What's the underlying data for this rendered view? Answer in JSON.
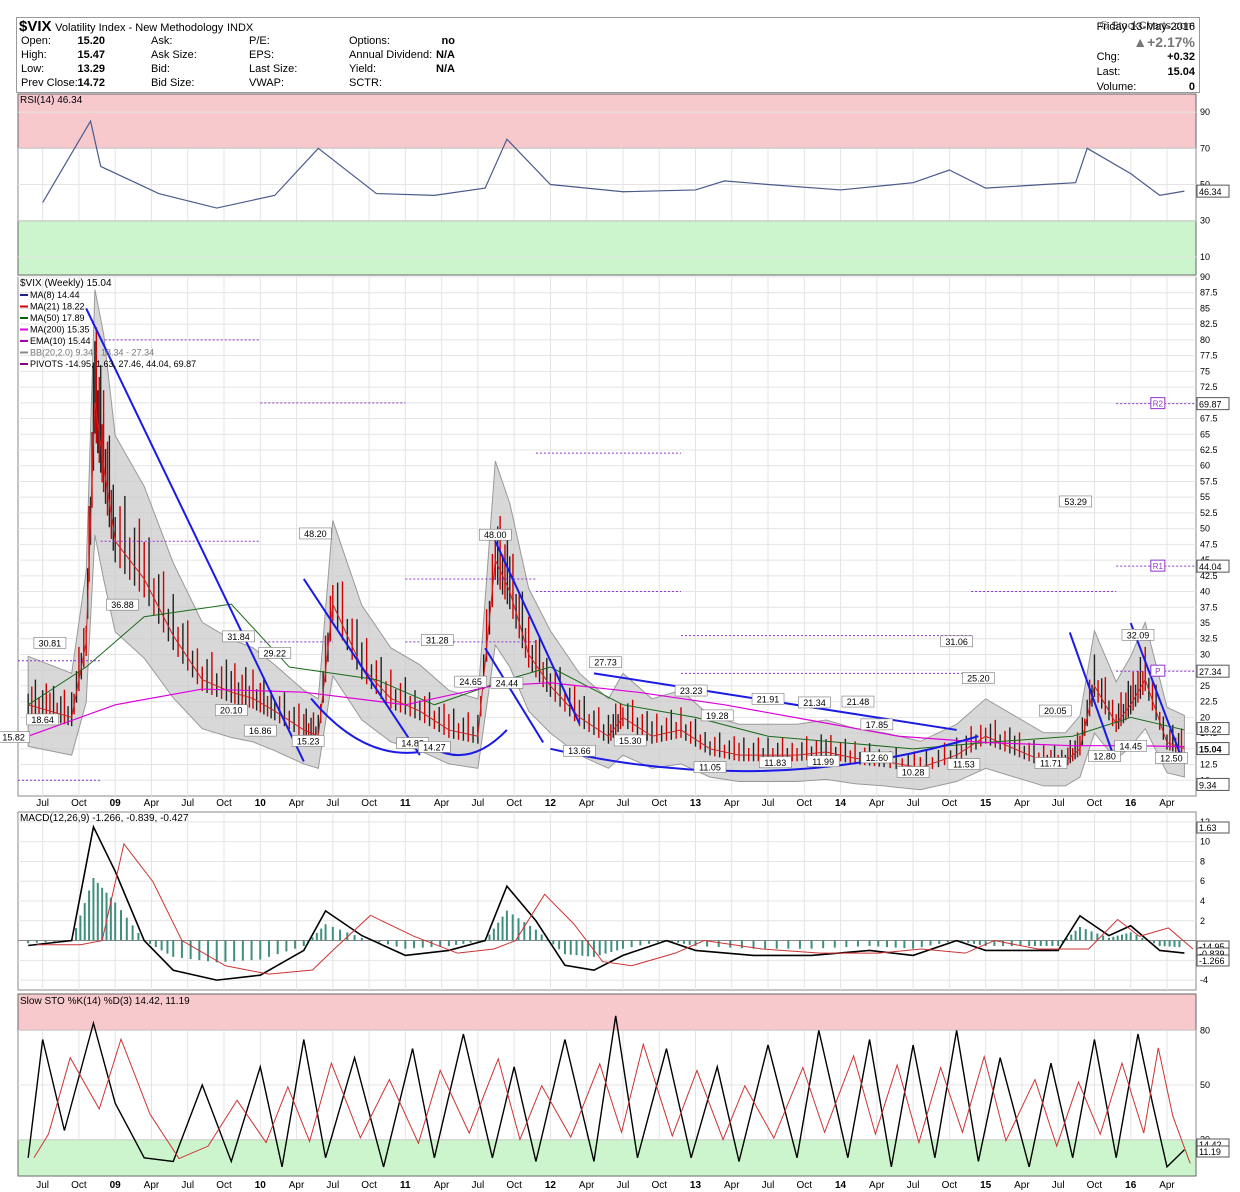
{
  "header": {
    "symbol": "$VIX",
    "name": "Volatility Index - New Methodology",
    "exchange": "INDX",
    "site": "© StockCharts.com",
    "date": "Friday  13-May-2016",
    "change_pct": "▲+2.17%",
    "quote_labels": [
      "Open:",
      "High:",
      "Low:",
      "Prev Close:"
    ],
    "quote_values": [
      "15.20",
      "15.47",
      "13.29",
      "14.72"
    ],
    "ask_labels": [
      "Ask:",
      "Ask Size:",
      "Bid:",
      "Bid Size:"
    ],
    "pe_labels": [
      "P/E:",
      "EPS:",
      "Last Size:",
      "VWAP:"
    ],
    "opt_labels": [
      "Options:",
      "Annual Dividend:",
      "Yield:",
      "SCTR:"
    ],
    "opt_values": [
      "no",
      "N/A",
      "N/A",
      ""
    ],
    "right_labels": [
      "Chg:",
      "Last:",
      "Volume:"
    ],
    "right_values": [
      "+0.32",
      "15.04",
      "0"
    ]
  },
  "chart_data": [
    {
      "type": "line",
      "panel": "rsi",
      "title": "RSI(14) 46.34",
      "ylim": [
        0,
        100
      ],
      "y_ticks": [
        10,
        30,
        50,
        70,
        90
      ],
      "bands": {
        "overbought": 70,
        "oversold": 30
      },
      "last_value_label": "46.34",
      "x": [
        2008.5,
        2008.83,
        2008.9,
        2009.3,
        2009.7,
        2010.1,
        2010.4,
        2010.8,
        2011.2,
        2011.55,
        2011.7,
        2012.0,
        2012.5,
        2013.0,
        2013.2,
        2013.5,
        2014.0,
        2014.5,
        2014.75,
        2015.0,
        2015.4,
        2015.62,
        2015.7,
        2016.0,
        2016.2,
        2016.37
      ],
      "values": [
        40,
        85,
        60,
        45,
        37,
        44,
        70,
        45,
        44,
        48,
        75,
        50,
        46,
        47,
        52,
        50,
        47,
        51,
        58,
        48,
        50,
        51,
        70,
        56,
        44,
        46.34
      ]
    },
    {
      "type": "bar",
      "panel": "price",
      "title": "$VIX (Weekly) 15.04",
      "legend": [
        "MA(8) 14.44",
        "MA(21) 18.22",
        "MA(50) 17.89",
        "MA(200) 15.35",
        "EMA(10) 15.44",
        "BB(20,2.0) 9.34 - 18.34 - 27.34",
        "PIVOTS -14.95, 1.63, 27.46, 44.04, 69.87"
      ],
      "legend_colors": [
        "#222288",
        "#cc0000",
        "#006600",
        "#dd00dd",
        "#aa00aa",
        "#888888",
        "#880088"
      ],
      "ylim": [
        7.5,
        90
      ],
      "y_ticks": [
        10,
        12.5,
        15,
        17.5,
        20,
        22.5,
        25,
        27.5,
        30,
        32.5,
        35,
        37.5,
        40,
        42.5,
        45,
        47.5,
        50,
        52.5,
        55,
        57.5,
        60,
        62.5,
        65,
        67.5,
        70,
        72.5,
        75,
        77.5,
        80,
        82.5,
        85,
        87.5,
        90
      ],
      "x": [
        2008.4,
        2008.55,
        2008.7,
        2008.8,
        2008.86,
        2008.92,
        2009.0,
        2009.2,
        2009.4,
        2009.6,
        2009.8,
        2009.95,
        2010.1,
        2010.3,
        2010.4,
        2010.5,
        2010.7,
        2010.9,
        2011.1,
        2011.3,
        2011.5,
        2011.62,
        2011.72,
        2011.85,
        2012.0,
        2012.2,
        2012.4,
        2012.5,
        2012.7,
        2012.9,
        2013.1,
        2013.3,
        2013.5,
        2013.7,
        2013.9,
        2014.1,
        2014.3,
        2014.55,
        2014.8,
        2015.0,
        2015.2,
        2015.4,
        2015.55,
        2015.65,
        2015.75,
        2015.9,
        2016.0,
        2016.1,
        2016.25,
        2016.37
      ],
      "values": [
        22,
        21,
        20,
        32,
        70,
        60,
        48,
        42,
        33,
        26,
        24,
        23,
        21,
        18,
        17,
        38,
        28,
        23,
        21,
        18,
        17,
        45,
        40,
        30,
        25,
        20,
        17,
        20,
        17,
        18,
        15,
        14,
        14,
        14,
        14.5,
        13.5,
        13,
        12,
        14,
        17,
        15,
        13,
        13,
        15,
        25,
        19,
        22,
        26,
        16,
        15.04
      ],
      "point_labels": [
        {
          "x": 2008.3,
          "y": 15.82,
          "text": "15.82"
        },
        {
          "x": 2008.5,
          "y": 18.64,
          "text": "18.64"
        },
        {
          "x": 2008.55,
          "y": 30.81,
          "text": "30.81"
        },
        {
          "x": 2009.05,
          "y": 36.88,
          "text": "36.88"
        },
        {
          "x": 2009.85,
          "y": 31.84,
          "text": "31.84"
        },
        {
          "x": 2009.8,
          "y": 20.1,
          "text": "20.10"
        },
        {
          "x": 2010.0,
          "y": 16.86,
          "text": "16.86"
        },
        {
          "x": 2010.1,
          "y": 29.22,
          "text": "29.22"
        },
        {
          "x": 2010.38,
          "y": 48.2,
          "text": "48.20"
        },
        {
          "x": 2010.33,
          "y": 15.23,
          "text": "15.23"
        },
        {
          "x": 2011.05,
          "y": 14.88,
          "text": "14.88"
        },
        {
          "x": 2011.2,
          "y": 14.27,
          "text": "14.27"
        },
        {
          "x": 2011.22,
          "y": 31.28,
          "text": "31.28"
        },
        {
          "x": 2011.45,
          "y": 24.65,
          "text": "24.65"
        },
        {
          "x": 2011.62,
          "y": 48.0,
          "text": "48.00"
        },
        {
          "x": 2011.7,
          "y": 24.44,
          "text": "24.44"
        },
        {
          "x": 2012.2,
          "y": 13.66,
          "text": "13.66"
        },
        {
          "x": 2012.38,
          "y": 27.73,
          "text": "27.73"
        },
        {
          "x": 2012.55,
          "y": 15.3,
          "text": "15.30"
        },
        {
          "x": 2012.97,
          "y": 23.23,
          "text": "23.23"
        },
        {
          "x": 2013.15,
          "y": 19.28,
          "text": "19.28"
        },
        {
          "x": 2013.1,
          "y": 11.05,
          "text": "11.05"
        },
        {
          "x": 2013.5,
          "y": 21.91,
          "text": "21.91"
        },
        {
          "x": 2013.55,
          "y": 11.83,
          "text": "11.83"
        },
        {
          "x": 2013.82,
          "y": 21.34,
          "text": "21.34"
        },
        {
          "x": 2013.88,
          "y": 11.99,
          "text": "11.99"
        },
        {
          "x": 2014.12,
          "y": 21.48,
          "text": "21.48"
        },
        {
          "x": 2014.25,
          "y": 17.85,
          "text": "17.85"
        },
        {
          "x": 2014.25,
          "y": 12.6,
          "text": "12.60"
        },
        {
          "x": 2014.5,
          "y": 10.28,
          "text": "10.28"
        },
        {
          "x": 2014.8,
          "y": 31.06,
          "text": "31.06"
        },
        {
          "x": 2014.95,
          "y": 25.2,
          "text": "25.20"
        },
        {
          "x": 2014.85,
          "y": 11.53,
          "text": "11.53"
        },
        {
          "x": 2015.48,
          "y": 20.05,
          "text": "20.05"
        },
        {
          "x": 2015.45,
          "y": 11.71,
          "text": "11.71"
        },
        {
          "x": 2015.62,
          "y": 53.29,
          "text": "53.29"
        },
        {
          "x": 2015.82,
          "y": 12.8,
          "text": "12.80"
        },
        {
          "x": 2016.0,
          "y": 14.45,
          "text": "14.45"
        },
        {
          "x": 2016.05,
          "y": 32.09,
          "text": "32.09"
        },
        {
          "x": 2016.28,
          "y": 12.5,
          "text": "12.50"
        }
      ],
      "right_labels": [
        "69.87",
        "44.04",
        "27.34",
        "18.22",
        "15.04",
        "9.34"
      ],
      "pivot_tags": [
        "R2",
        "R1",
        "P"
      ]
    },
    {
      "type": "line",
      "panel": "macd",
      "title": "MACD(12,26,9) -1.266, -0.839, -0.427",
      "ylim": [
        -5,
        13
      ],
      "y_ticks": [
        -4,
        -2,
        2,
        4,
        6,
        8,
        10,
        12
      ],
      "right_labels": [
        "1.63",
        "-14.95",
        "-0.839",
        "-1.266"
      ],
      "x": [
        2008.4,
        2008.7,
        2008.85,
        2009.0,
        2009.2,
        2009.4,
        2009.7,
        2010.0,
        2010.3,
        2010.45,
        2010.7,
        2011.0,
        2011.3,
        2011.55,
        2011.7,
        2011.9,
        2012.1,
        2012.3,
        2012.5,
        2012.8,
        2013.0,
        2013.4,
        2013.8,
        2014.2,
        2014.5,
        2014.8,
        2015.0,
        2015.3,
        2015.5,
        2015.65,
        2015.85,
        2016.0,
        2016.2,
        2016.37
      ],
      "values": [
        -0.5,
        0,
        11.5,
        7,
        0,
        -3,
        -4,
        -3.5,
        -1,
        3,
        0.5,
        -1.5,
        -1,
        0,
        5.5,
        2,
        -2.5,
        -3,
        -1.5,
        0,
        -1,
        -1.5,
        -1.5,
        -1,
        -1.5,
        0,
        -1,
        -1,
        -1,
        2.5,
        0.5,
        1.5,
        -1,
        -1.266
      ]
    },
    {
      "type": "line",
      "panel": "sto",
      "title": "Slow STO %K(14) %D(3) 14.42, 11.19",
      "ylim": [
        0,
        100
      ],
      "y_ticks": [
        20,
        50,
        80
      ],
      "bands": {
        "overbought": 80,
        "oversold": 20
      },
      "right_labels": [
        "14.42",
        "11.19"
      ],
      "x": [
        2008.4,
        2008.5,
        2008.65,
        2008.85,
        2009.0,
        2009.2,
        2009.4,
        2009.6,
        2009.8,
        2010.0,
        2010.15,
        2010.3,
        2010.45,
        2010.65,
        2010.85,
        2011.05,
        2011.2,
        2011.4,
        2011.6,
        2011.75,
        2011.9,
        2012.1,
        2012.3,
        2012.45,
        2012.6,
        2012.8,
        2012.97,
        2013.15,
        2013.3,
        2013.5,
        2013.7,
        2013.85,
        2014.05,
        2014.2,
        2014.35,
        2014.5,
        2014.65,
        2014.8,
        2014.95,
        2015.1,
        2015.3,
        2015.45,
        2015.6,
        2015.75,
        2015.9,
        2016.05,
        2016.15,
        2016.25,
        2016.37
      ],
      "values": [
        10,
        75,
        25,
        84,
        40,
        10,
        8,
        50,
        8,
        60,
        5,
        75,
        10,
        65,
        5,
        70,
        10,
        78,
        10,
        60,
        8,
        75,
        8,
        88,
        10,
        70,
        10,
        60,
        8,
        72,
        10,
        80,
        10,
        75,
        5,
        72,
        10,
        80,
        8,
        65,
        5,
        62,
        10,
        75,
        10,
        78,
        40,
        5,
        14.42
      ]
    }
  ],
  "x_axis_labels": [
    "Jul",
    "Oct",
    "09",
    "Apr",
    "Jul",
    "Oct",
    "10",
    "Apr",
    "Jul",
    "Oct",
    "11",
    "Apr",
    "Jul",
    "Oct",
    "12",
    "Apr",
    "Jul",
    "Oct",
    "13",
    "Apr",
    "Jul",
    "Oct",
    "14",
    "Apr",
    "Jul",
    "Oct",
    "15",
    "Apr",
    "Jul",
    "Oct",
    "16",
    "Apr"
  ],
  "colors": {
    "overbought_band": "#f7c9cd",
    "oversold_band": "#cdf5cd",
    "trendline": "#1a1ae6",
    "rsi_line": "#4a5a8c",
    "bb_fill": "#c8c8c8",
    "ma200": "#dd00dd",
    "pivot": "#8e33cc",
    "macd_hist": "#3f8f7f"
  }
}
